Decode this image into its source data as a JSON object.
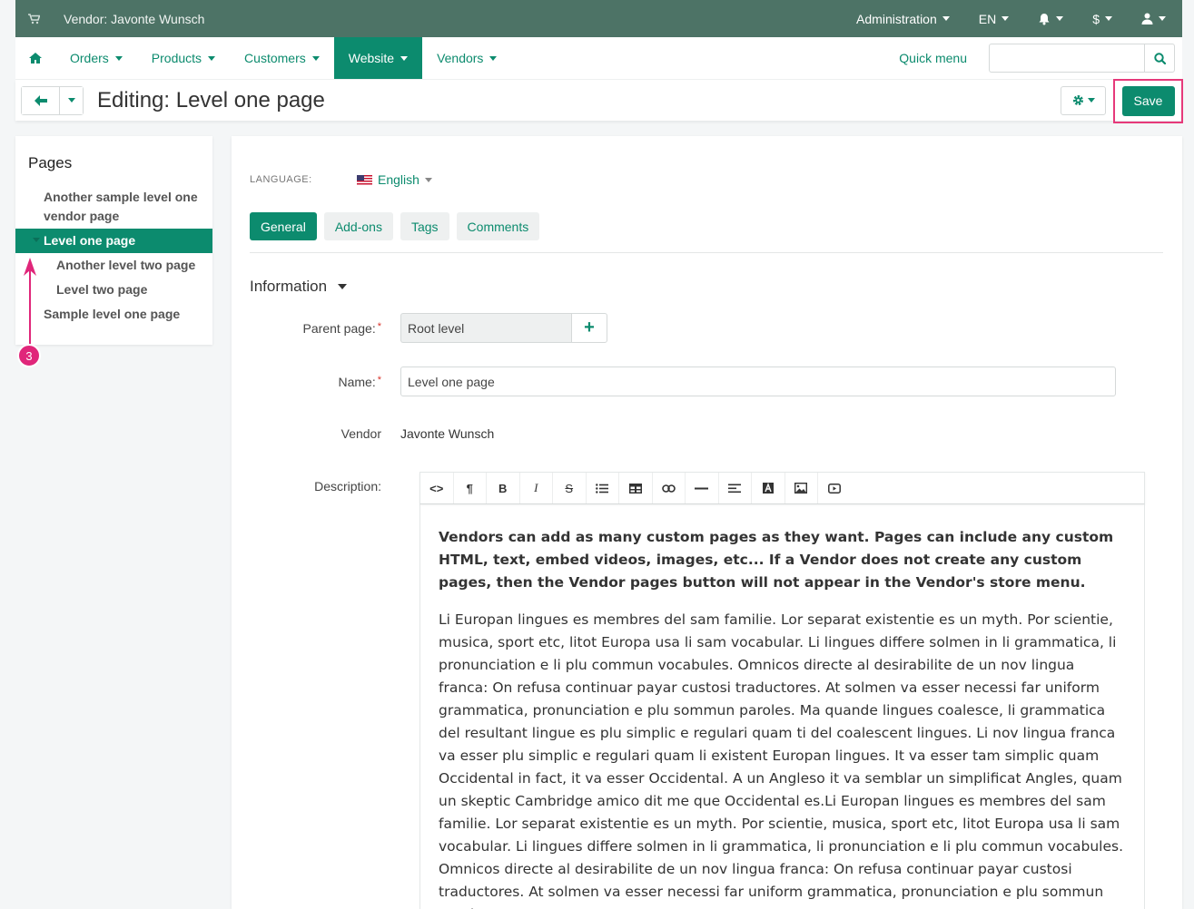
{
  "topbar": {
    "vendor": "Vendor: Javonte Wunsch",
    "administration": "Administration",
    "language": "EN",
    "currency": "$"
  },
  "nav": {
    "items": [
      {
        "label": "Orders"
      },
      {
        "label": "Products"
      },
      {
        "label": "Customers"
      },
      {
        "label": "Website"
      },
      {
        "label": "Vendors"
      }
    ],
    "quick_menu": "Quick menu",
    "search_value": ""
  },
  "header": {
    "title": "Editing: Level one page",
    "save_label": "Save"
  },
  "sidebar": {
    "title": "Pages",
    "items": [
      {
        "label": "Another sample level one vendor page"
      },
      {
        "label": "Level one page"
      },
      {
        "label": "Another level two page"
      },
      {
        "label": "Level two page"
      },
      {
        "label": "Sample level one page"
      }
    ]
  },
  "annotation": {
    "step": "3"
  },
  "form": {
    "language_label": "LANGUAGE:",
    "language_value": "English",
    "tabs": [
      {
        "label": "General"
      },
      {
        "label": "Add-ons"
      },
      {
        "label": "Tags"
      },
      {
        "label": "Comments"
      }
    ],
    "section_title": "Information",
    "parent_label": "Parent page:",
    "parent_value": "Root level",
    "name_label": "Name:",
    "name_value": "Level one page",
    "vendor_label": "Vendor",
    "vendor_value": "Javonte Wunsch",
    "description_label": "Description:",
    "description_lead": "Vendors can add as many custom pages as they want. Pages can include any custom HTML, text, embed videos, images, etc... If a Vendor does not create any custom pages, then the Vendor pages button will not appear in the Vendor's store menu.",
    "description_body": "Li Europan lingues es membres del sam familie. Lor separat existentie es un myth. Por scientie, musica, sport etc, litot Europa usa li sam vocabular. Li lingues differe solmen in li grammatica, li pronunciation e li plu commun vocabules. Omnicos directe al desirabilite de un nov lingua franca: On refusa continuar payar custosi traductores. At solmen va esser necessi far uniform grammatica, pronunciation e plu sommun paroles. Ma quande lingues coalesce, li grammatica del resultant lingue es plu simplic e regulari quam ti del coalescent lingues. Li nov lingua franca va esser plu simplic e regulari quam li existent Europan lingues. It va esser tam simplic quam Occidental in fact, it va esser Occidental. A un Angleso it va semblar un simplificat Angles, quam un skeptic Cambridge amico dit me que Occidental es.Li Europan lingues es membres del sam familie. Lor separat existentie es un myth. Por scientie, musica, sport etc, litot Europa usa li sam vocabular. Li lingues differe solmen in li grammatica, li pronunciation e li plu commun vocabules. Omnicos directe al desirabilite de un nov lingua franca: On refusa continuar payar custosi traductores. At solmen va esser necessi far uniform grammatica, pronunciation e plu sommun paroles."
  },
  "colors": {
    "topbar": "#4d7366",
    "accent": "#0c8b6e",
    "highlight": "#e6397a"
  }
}
